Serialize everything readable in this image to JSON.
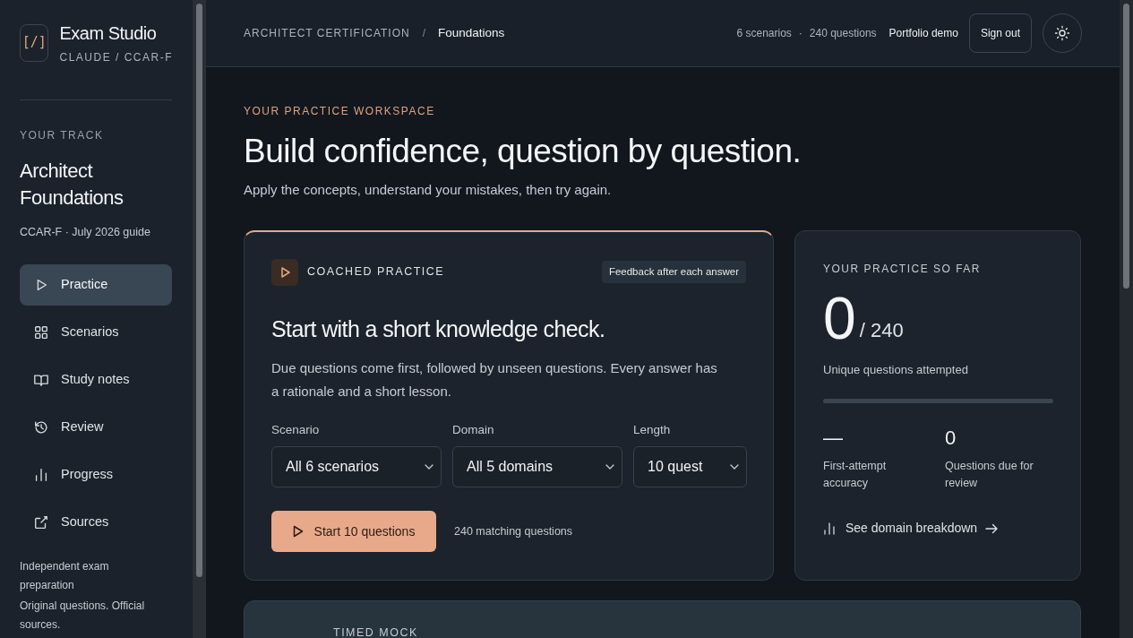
{
  "sidebar": {
    "logo_glyph": "[/]",
    "app_name": "Exam Studio",
    "app_subtitle": "CLAUDE / CCAR-F",
    "track_label": "YOUR TRACK",
    "track_title": "Architect Foundations",
    "track_meta": "CCAR-F · July 2026 guide",
    "nav": [
      {
        "label": "Practice",
        "selected": true
      },
      {
        "label": "Scenarios",
        "selected": false
      },
      {
        "label": "Study notes",
        "selected": false
      },
      {
        "label": "Review",
        "selected": false
      },
      {
        "label": "Progress",
        "selected": false
      },
      {
        "label": "Sources",
        "selected": false
      }
    ],
    "footer": [
      "Independent exam preparation",
      "Original questions. Official sources."
    ]
  },
  "header": {
    "breadcrumb": [
      "ARCHITECT CERTIFICATION",
      "/",
      "Foundations"
    ],
    "stats": [
      "6 scenarios",
      "·",
      "240 questions"
    ],
    "account": "Portfolio demo",
    "sign_out": "Sign out"
  },
  "hero": {
    "eyebrow": "YOUR PRACTICE WORKSPACE",
    "title": "Build confidence, question by question.",
    "subtitle": "Apply the concepts, understand your mistakes, then try again."
  },
  "practice_card": {
    "label": "COACHED PRACTICE",
    "badge": "Feedback after each answer",
    "title": "Start with a short knowledge check.",
    "description": "Due questions come first, followed by unseen questions. Every answer has a rationale and a short lesson.",
    "filters": [
      {
        "label": "Scenario",
        "value": "All 6 scenarios"
      },
      {
        "label": "Domain",
        "value": "All 5 domains"
      },
      {
        "label": "Length",
        "value": "10 quest"
      }
    ],
    "start_button": "Start 10 questions",
    "match_count": "240 matching questions"
  },
  "stats_card": {
    "label": "YOUR PRACTICE SO FAR",
    "count": "0",
    "total": "/ 240",
    "count_caption": "Unique questions attempted",
    "progress": {
      "level": 0
    },
    "metrics": [
      {
        "value": "—",
        "caption": "First-attempt accuracy"
      },
      {
        "value": "0",
        "caption": "Questions due for review"
      }
    ],
    "link": "See domain breakdown"
  },
  "next_card": {
    "label": "TIMED MOCK"
  }
}
